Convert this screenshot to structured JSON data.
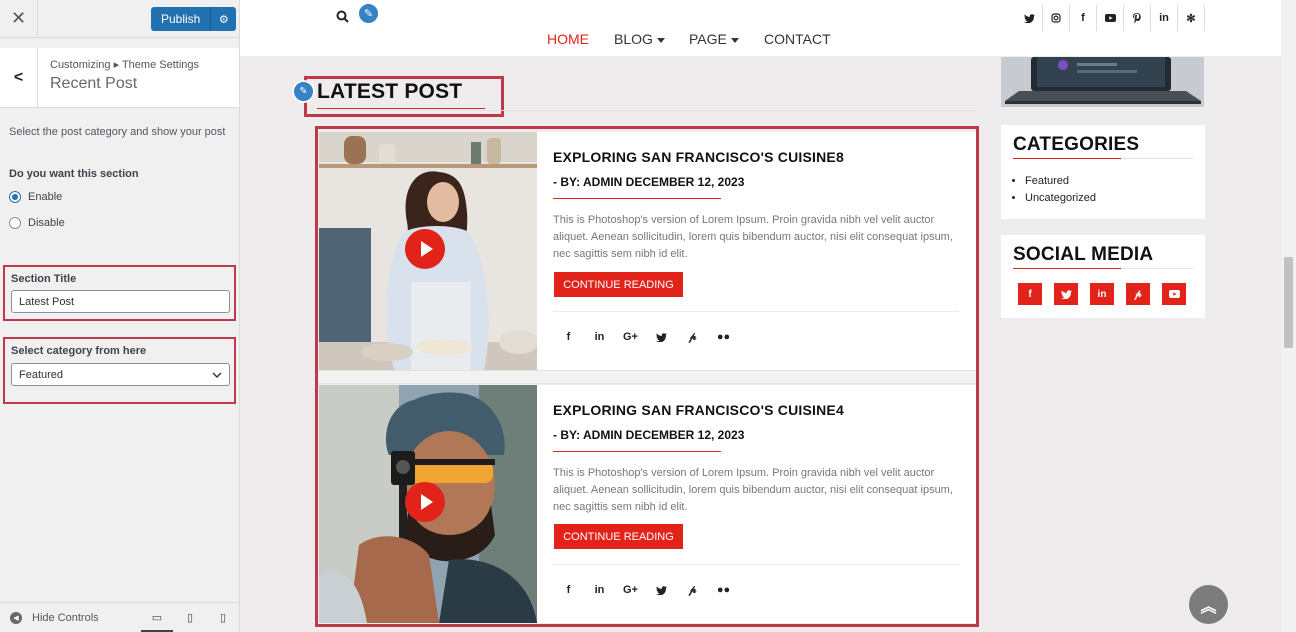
{
  "customizer": {
    "close_label": "✕",
    "publish_label": "Publish",
    "breadcrumb": "Customizing ▸ Theme Settings",
    "section_title": "Recent Post",
    "description": "Select the post category and show your post",
    "question": "Do you want this section",
    "radio_enable": "Enable",
    "radio_disable": "Disable",
    "field_title_label": "Section Title",
    "field_title_value": "Latest Post",
    "field_category_label": "Select category from here",
    "field_category_value": "Featured",
    "hide_controls": "Hide Controls"
  },
  "nav": {
    "home": "HOME",
    "blog": "BLOG",
    "page": "PAGE",
    "contact": "CONTACT",
    "accent": "#e2231a"
  },
  "section": {
    "title": "LATEST POST"
  },
  "posts": [
    {
      "title": "EXPLORING SAN FRANCISCO'S CUISINE8",
      "meta": "- BY: ADMIN DECEMBER 12, 2023",
      "excerpt": "This is Photoshop's version of Lorem Ipsum. Proin gravida nibh vel velit auctor aliquet. Aenean sollicitudin, lorem quis bibendum auctor, nisi elit consequat ipsum, nec sagittis sem nibh id elit.",
      "button": "CONTINUE READING"
    },
    {
      "title": "EXPLORING SAN FRANCISCO'S CUISINE4",
      "meta": "- BY: ADMIN DECEMBER 12, 2023",
      "excerpt": "This is Photoshop's version of Lorem Ipsum. Proin gravida nibh vel velit auctor aliquet. Aenean sollicitudin, lorem quis bibendum auctor, nisi elit consequat ipsum, nec sagittis sem nibh id elit.",
      "button": "CONTINUE READING"
    }
  ],
  "sidebar_widgets": {
    "categories_title": "CATEGORIES",
    "categories": [
      "Featured",
      "Uncategorized"
    ],
    "social_title": "SOCIAL MEDIA"
  },
  "icons": {
    "share": [
      "f",
      "in",
      "G+",
      "t",
      "p",
      "fl"
    ],
    "top_social": [
      "t",
      "ig",
      "f",
      "yt",
      "p",
      "in",
      "yelp"
    ],
    "social_widget": [
      "f",
      "t",
      "in",
      "p",
      "yt"
    ]
  }
}
